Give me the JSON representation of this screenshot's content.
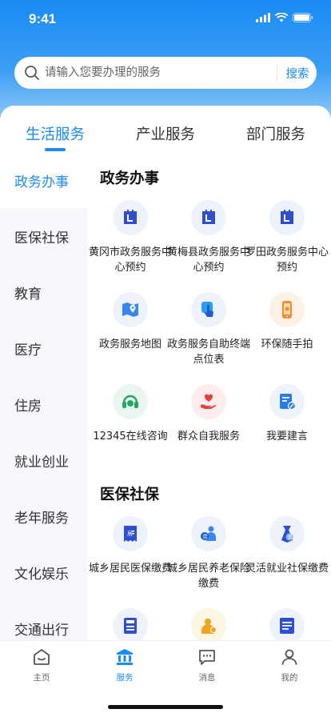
{
  "status_bar": {
    "time": "9:41"
  },
  "colors": {
    "primary": "#1b8bf5",
    "sidebar_bg": "#f5f7fa",
    "icon_bg": "#eef3fb"
  },
  "search": {
    "placeholder": "请输入您要办理的服务",
    "button_label": "搜索"
  },
  "tabs": [
    {
      "label": "生活服务",
      "active": true
    },
    {
      "label": "产业服务",
      "active": false
    },
    {
      "label": "部门服务",
      "active": false
    }
  ],
  "sidebar": {
    "items": [
      {
        "label": "政务办事",
        "active": true
      },
      {
        "label": "医保社保"
      },
      {
        "label": "教育"
      },
      {
        "label": "医疗"
      },
      {
        "label": "住房"
      },
      {
        "label": "就业创业"
      },
      {
        "label": "老年服务"
      },
      {
        "label": "文化娱乐"
      },
      {
        "label": "交通出行"
      }
    ]
  },
  "sections": [
    {
      "title": "政务办事",
      "items": [
        {
          "icon": "calendar-icon",
          "label": "黄冈市政务服务中心预约"
        },
        {
          "icon": "calendar-icon",
          "label": "黄梅县政务服务中心预约"
        },
        {
          "icon": "calendar-icon",
          "label": "罗田政务服务中心预约"
        },
        {
          "icon": "map-pin-icon",
          "label": "政务服务地图"
        },
        {
          "icon": "touch-icon",
          "label": "政务服务自助终端点位表"
        },
        {
          "icon": "camera-phone-icon",
          "label": "环保随手拍"
        },
        {
          "icon": "headset-icon",
          "label": "12345在线咨询"
        },
        {
          "icon": "heart-hand-icon",
          "label": "群众自我服务"
        },
        {
          "icon": "suggestion-icon",
          "label": "我要建言"
        }
      ]
    },
    {
      "title": "医保社保",
      "items": [
        {
          "icon": "medical-insurance-icon",
          "label": "城乡居民医保缴费"
        },
        {
          "icon": "pension-icon",
          "label": "城乡居民养老保险缴费"
        },
        {
          "icon": "flexible-employment-icon",
          "label": "灵活就业社保缴费"
        },
        {
          "icon": "receipt-icon",
          "label": ""
        },
        {
          "icon": "person-badge-icon",
          "label": ""
        },
        {
          "icon": "document-icon",
          "label": ""
        }
      ]
    }
  ],
  "tabbar": [
    {
      "icon": "home-icon",
      "label": "主页"
    },
    {
      "icon": "service-icon",
      "label": "服务",
      "active": true
    },
    {
      "icon": "message-icon",
      "label": "消息"
    },
    {
      "icon": "profile-icon",
      "label": "我的"
    }
  ]
}
